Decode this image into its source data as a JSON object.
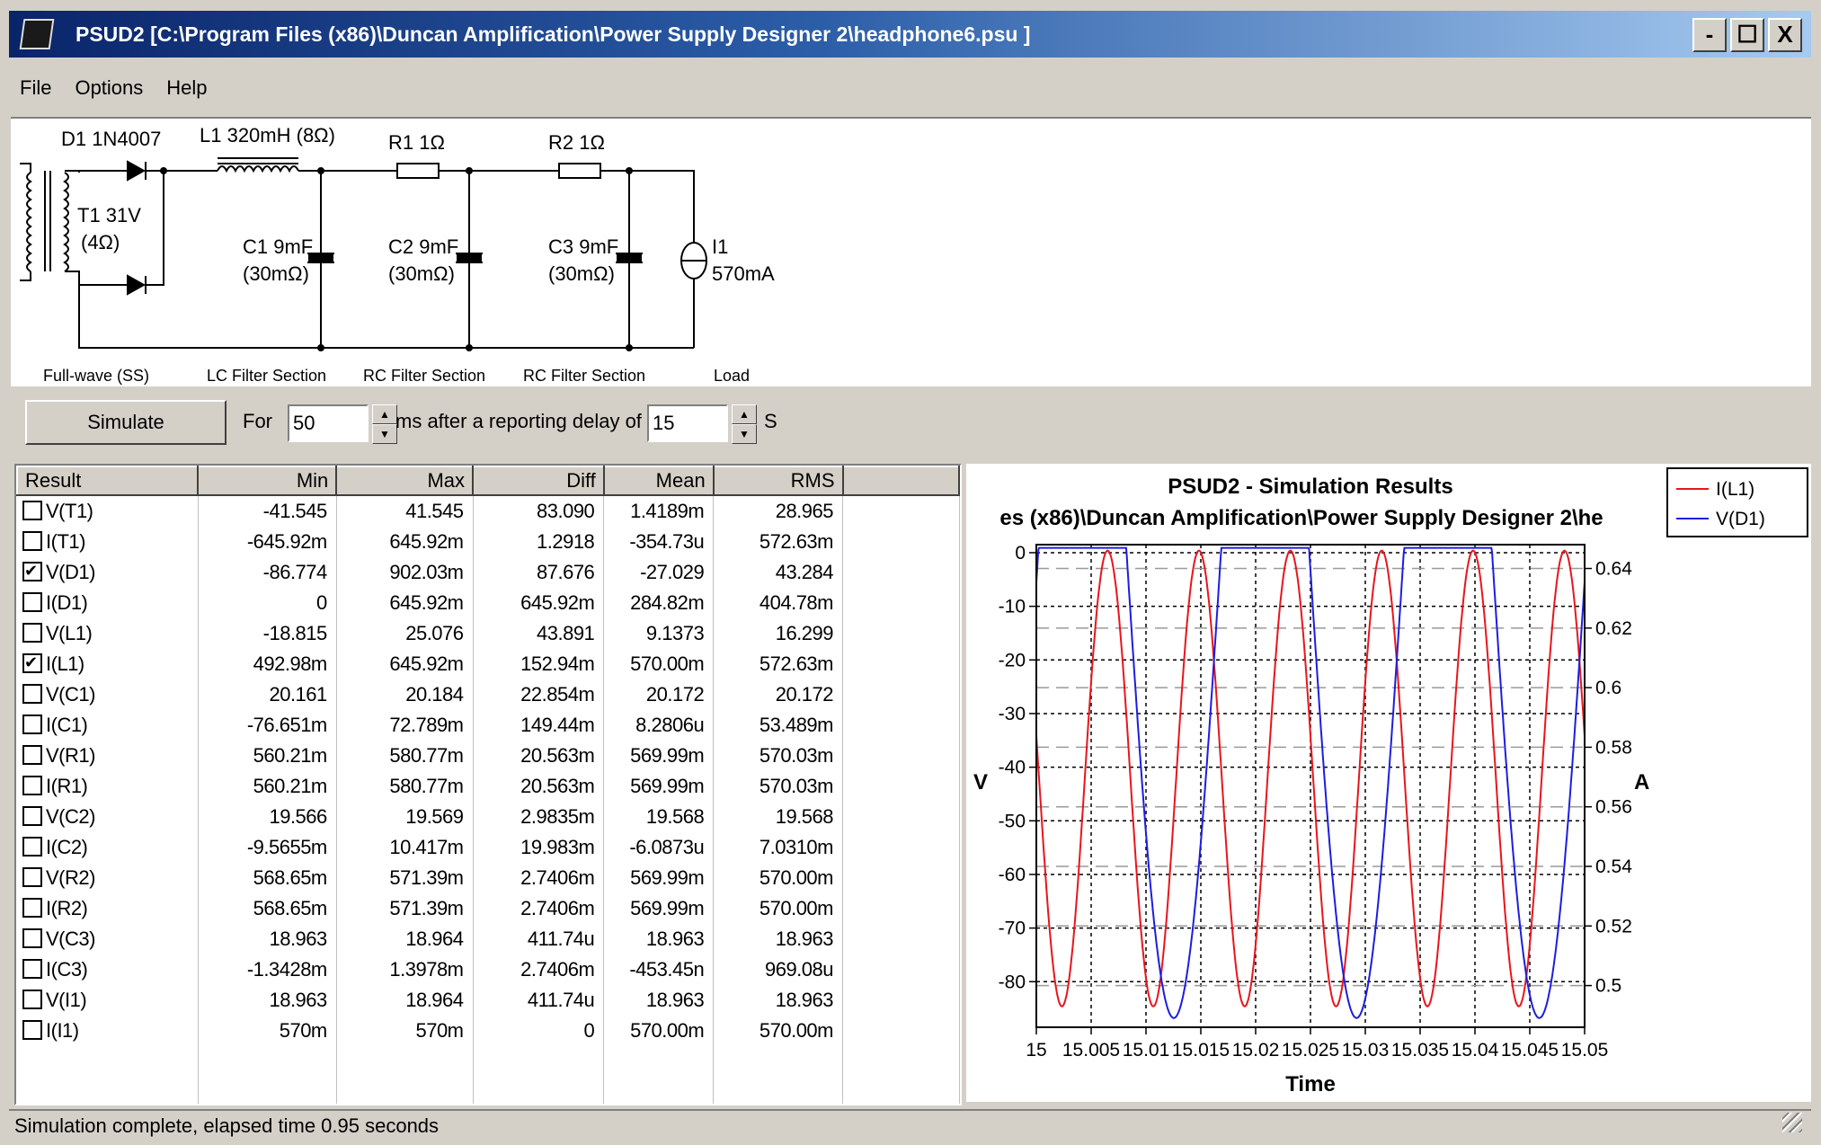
{
  "window": {
    "title": "PSUD2  [C:\\Program Files (x86)\\Duncan Amplification\\Power Supply Designer 2\\headphone6.psu ]",
    "controls": [
      "-",
      "☐",
      "X"
    ]
  },
  "menu": {
    "items": [
      "File",
      "Options",
      "Help"
    ]
  },
  "schematic": {
    "d1": "D1 1N4007",
    "t1_a": "T1 31V",
    "t1_b": "(4Ω)",
    "l1": "L1 320mH (8Ω)",
    "r1": "R1 1Ω",
    "r2": "R2 1Ω",
    "c1_a": "C1 9mF",
    "c1_b": "(30mΩ)",
    "c2_a": "C2 9mF",
    "c2_b": "(30mΩ)",
    "c3_a": "C3 9mF",
    "c3_b": "(30mΩ)",
    "i1_a": "I1",
    "i1_b": "570mA",
    "sections": [
      "Full-wave (SS)",
      "LC Filter Section",
      "RC Filter Section",
      "RC Filter Section",
      "Load"
    ]
  },
  "controls": {
    "simulate_label": "Simulate",
    "for_label": "For",
    "duration_value": "50",
    "ms_label": "ms  after a reporting delay of",
    "delay_value": "15",
    "s_label": "S"
  },
  "table": {
    "headers": [
      "Result",
      "Min",
      "Max",
      "Diff",
      "Mean",
      "RMS"
    ],
    "rows": [
      {
        "name": "V(T1)",
        "checked": false,
        "min": "-41.545",
        "max": "41.545",
        "diff": "83.090",
        "mean": "1.4189m",
        "rms": "28.965"
      },
      {
        "name": "I(T1)",
        "checked": false,
        "min": "-645.92m",
        "max": "645.92m",
        "diff": "1.2918",
        "mean": "-354.73u",
        "rms": "572.63m"
      },
      {
        "name": "V(D1)",
        "checked": true,
        "min": "-86.774",
        "max": "902.03m",
        "diff": "87.676",
        "mean": "-27.029",
        "rms": "43.284"
      },
      {
        "name": "I(D1)",
        "checked": false,
        "min": "0",
        "max": "645.92m",
        "diff": "645.92m",
        "mean": "284.82m",
        "rms": "404.78m"
      },
      {
        "name": "V(L1)",
        "checked": false,
        "min": "-18.815",
        "max": "25.076",
        "diff": "43.891",
        "mean": "9.1373",
        "rms": "16.299"
      },
      {
        "name": "I(L1)",
        "checked": true,
        "min": "492.98m",
        "max": "645.92m",
        "diff": "152.94m",
        "mean": "570.00m",
        "rms": "572.63m"
      },
      {
        "name": "V(C1)",
        "checked": false,
        "min": "20.161",
        "max": "20.184",
        "diff": "22.854m",
        "mean": "20.172",
        "rms": "20.172"
      },
      {
        "name": "I(C1)",
        "checked": false,
        "min": "-76.651m",
        "max": "72.789m",
        "diff": "149.44m",
        "mean": "8.2806u",
        "rms": "53.489m"
      },
      {
        "name": "V(R1)",
        "checked": false,
        "min": "560.21m",
        "max": "580.77m",
        "diff": "20.563m",
        "mean": "569.99m",
        "rms": "570.03m"
      },
      {
        "name": "I(R1)",
        "checked": false,
        "min": "560.21m",
        "max": "580.77m",
        "diff": "20.563m",
        "mean": "569.99m",
        "rms": "570.03m"
      },
      {
        "name": "V(C2)",
        "checked": false,
        "min": "19.566",
        "max": "19.569",
        "diff": "2.9835m",
        "mean": "19.568",
        "rms": "19.568"
      },
      {
        "name": "I(C2)",
        "checked": false,
        "min": "-9.5655m",
        "max": "10.417m",
        "diff": "19.983m",
        "mean": "-6.0873u",
        "rms": "7.0310m"
      },
      {
        "name": "V(R2)",
        "checked": false,
        "min": "568.65m",
        "max": "571.39m",
        "diff": "2.7406m",
        "mean": "569.99m",
        "rms": "570.00m"
      },
      {
        "name": "I(R2)",
        "checked": false,
        "min": "568.65m",
        "max": "571.39m",
        "diff": "2.7406m",
        "mean": "569.99m",
        "rms": "570.00m"
      },
      {
        "name": "V(C3)",
        "checked": false,
        "min": "18.963",
        "max": "18.964",
        "diff": "411.74u",
        "mean": "18.963",
        "rms": "18.963"
      },
      {
        "name": "I(C3)",
        "checked": false,
        "min": "-1.3428m",
        "max": "1.3978m",
        "diff": "2.7406m",
        "mean": "-453.45n",
        "rms": "969.08u"
      },
      {
        "name": "V(I1)",
        "checked": false,
        "min": "18.963",
        "max": "18.964",
        "diff": "411.74u",
        "mean": "18.963",
        "rms": "18.963"
      },
      {
        "name": "I(I1)",
        "checked": false,
        "min": "570m",
        "max": "570m",
        "diff": "0",
        "mean": "570.00m",
        "rms": "570.00m"
      }
    ]
  },
  "chart_data": {
    "type": "line",
    "title": "PSUD2 - Simulation Results",
    "subtitle": "es (x86)\\Duncan Amplification\\Power Supply Designer 2\\he",
    "xlabel": "Time",
    "ylabel_left": "V",
    "ylabel_right": "A",
    "x_ticks": [
      "15",
      "15.005",
      "15.01",
      "15.015",
      "15.02",
      "15.025",
      "15.03",
      "15.035",
      "15.04",
      "15.045",
      "15.05"
    ],
    "xlim": [
      15,
      15.05
    ],
    "y_left_ticks": [
      "0",
      "-10",
      "-20",
      "-30",
      "-40",
      "-50",
      "-60",
      "-70",
      "-80"
    ],
    "ylim_left": [
      -88.5,
      1.5
    ],
    "y_right_ticks": [
      "0.64",
      "0.62",
      "0.6",
      "0.58",
      "0.56",
      "0.54",
      "0.52",
      "0.5"
    ],
    "ylim_right": [
      0.486,
      0.648
    ],
    "legend": [
      {
        "name": "I(L1)",
        "color": "#e8151c"
      },
      {
        "name": "V(D1)",
        "color": "#1d1de0"
      }
    ],
    "legend_position": "top-right outside",
    "grid": true,
    "series": [
      {
        "name": "I(L1)",
        "axis": "right",
        "color": "#e8151c",
        "period_ms": 8.333,
        "min": 0.493,
        "max": 0.646,
        "peak_at_ms": 6.5
      },
      {
        "name": "V(D1)",
        "axis": "left",
        "color": "#1d1de0",
        "period_ms": 16.667,
        "min": -86.774,
        "max": 0.902,
        "conduction_start_ms": 0.2,
        "conduction_end_ms": 8.2
      }
    ]
  },
  "status": {
    "text": "Simulation complete, elapsed time 0.95 seconds"
  }
}
